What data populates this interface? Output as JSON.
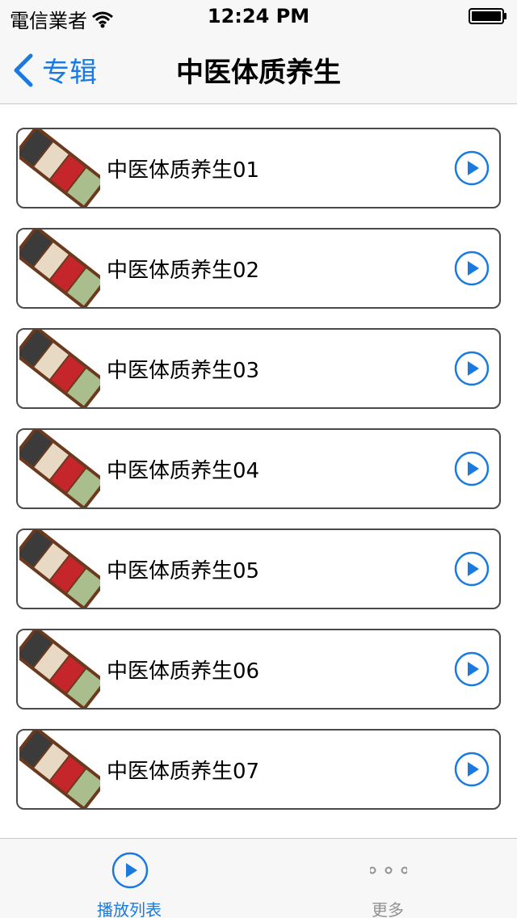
{
  "status_bar": {
    "carrier": "電信業者",
    "time": "12:24 PM"
  },
  "nav": {
    "back_label": "专辑",
    "title": "中医体质养生"
  },
  "list": {
    "items": [
      {
        "label": "中医体质养生01"
      },
      {
        "label": "中医体质养生02"
      },
      {
        "label": "中医体质养生03"
      },
      {
        "label": "中医体质养生04"
      },
      {
        "label": "中医体质养生05"
      },
      {
        "label": "中医体质养生06"
      },
      {
        "label": "中医体质养生07"
      }
    ]
  },
  "tab_bar": {
    "tabs": [
      {
        "label": "播放列表",
        "icon": "play-circle-icon",
        "selected": true
      },
      {
        "label": "更多",
        "icon": "more-dots-icon",
        "selected": false
      }
    ]
  },
  "colors": {
    "accent": "#1a7ae0",
    "inactive": "#929292",
    "border": "#4a4a4a"
  }
}
